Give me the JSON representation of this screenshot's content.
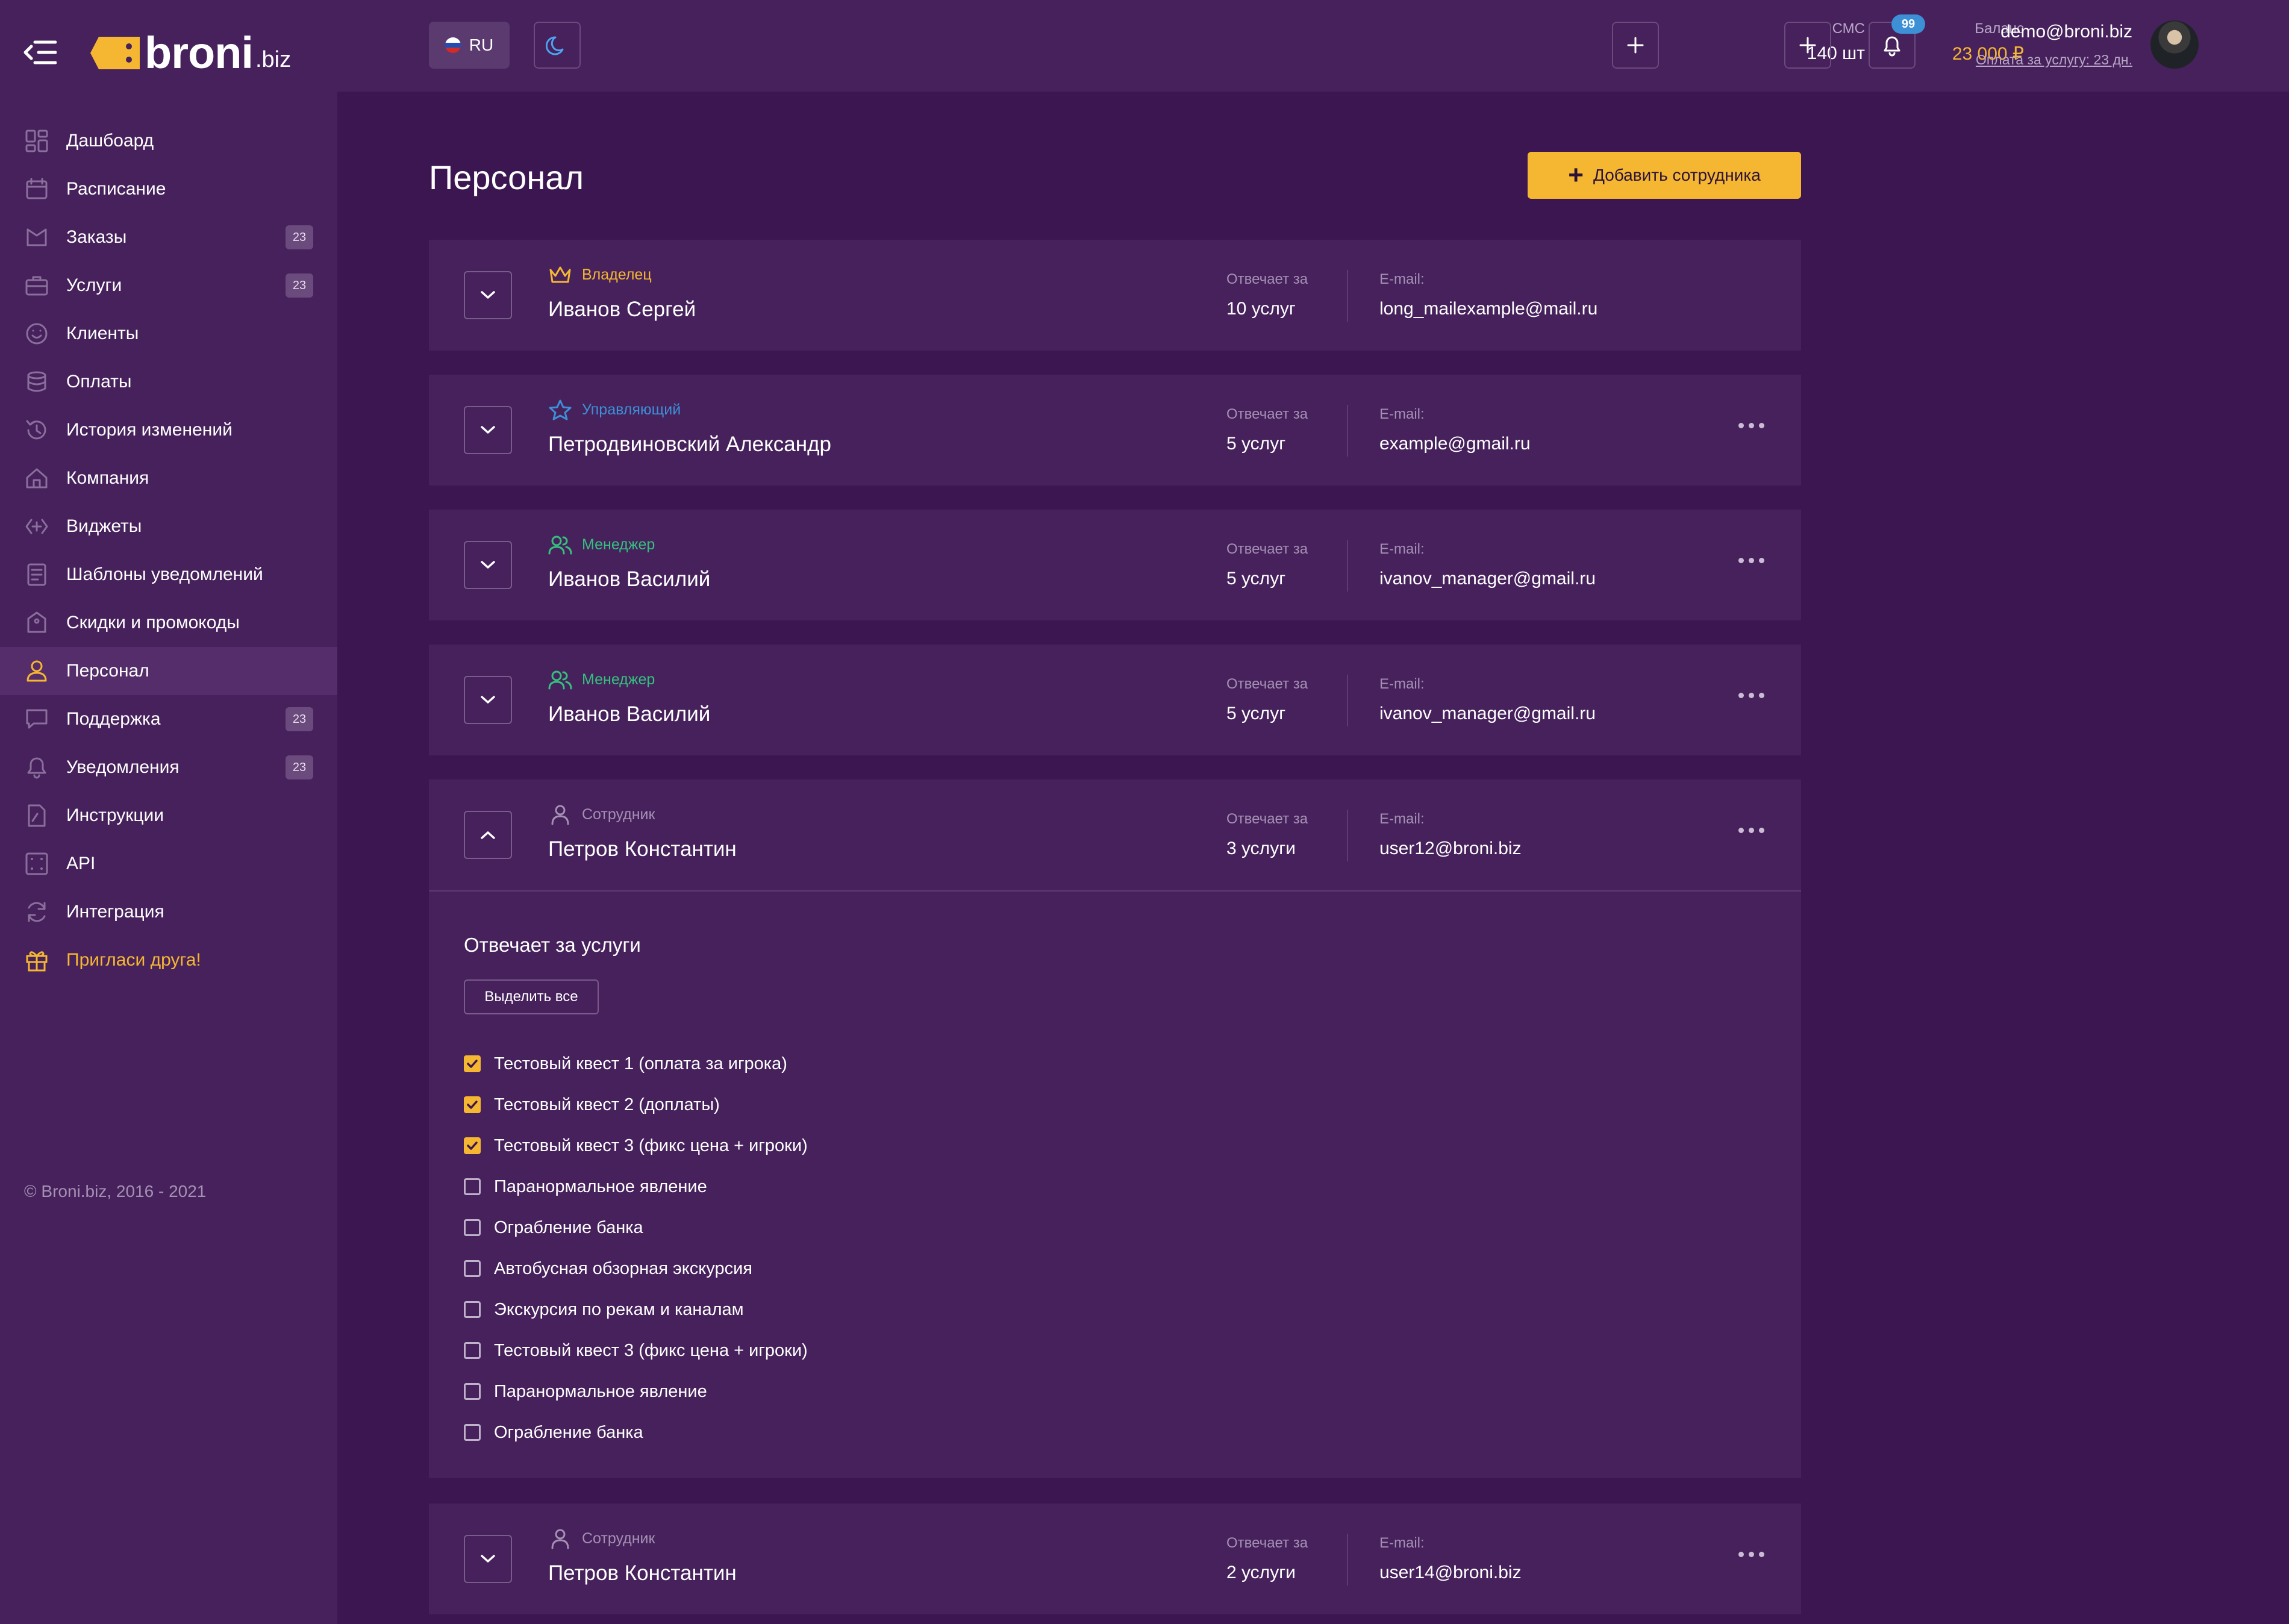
{
  "brand": {
    "name": "broni",
    "suffix": ".biz"
  },
  "sidebar": {
    "items": [
      {
        "label": "Дашбоард",
        "icon": "dashboard-icon",
        "badge": ""
      },
      {
        "label": "Расписание",
        "icon": "calendar-icon",
        "badge": ""
      },
      {
        "label": "Заказы",
        "icon": "orders-icon",
        "badge": "23"
      },
      {
        "label": "Услуги",
        "icon": "briefcase-icon",
        "badge": "23"
      },
      {
        "label": "Клиенты",
        "icon": "smile-icon",
        "badge": ""
      },
      {
        "label": "Оплаты",
        "icon": "coins-icon",
        "badge": ""
      },
      {
        "label": "История изменений",
        "icon": "history-icon",
        "badge": ""
      },
      {
        "label": "Компания",
        "icon": "home-icon",
        "badge": ""
      },
      {
        "label": "Виджеты",
        "icon": "widget-icon",
        "badge": ""
      },
      {
        "label": "Шаблоны уведомлений",
        "icon": "template-icon",
        "badge": ""
      },
      {
        "label": "Скидки и промокоды",
        "icon": "tag-icon",
        "badge": ""
      },
      {
        "label": "Персонал",
        "icon": "user-icon",
        "badge": ""
      },
      {
        "label": "Поддержка",
        "icon": "chat-icon",
        "badge": "23"
      },
      {
        "label": "Уведомления",
        "icon": "bell-icon",
        "badge": "23"
      },
      {
        "label": "Инструкции",
        "icon": "document-icon",
        "badge": ""
      },
      {
        "label": "API",
        "icon": "api-icon",
        "badge": ""
      },
      {
        "label": "Интеграция",
        "icon": "sync-icon",
        "badge": ""
      },
      {
        "label": "Пригласи друга!",
        "icon": "gift-icon",
        "badge": ""
      }
    ],
    "active_index": 11,
    "copyright": "© Broni.biz, 2016 - 2021"
  },
  "topbar": {
    "lang": "RU",
    "sms_label": "СМС",
    "sms_value": "140 шт",
    "balance_label": "Баланс",
    "balance_value": "23 000 ₽",
    "notifications_count": "99",
    "user_email": "demo@broni.biz",
    "user_subscription": "Оплата за услугу: 23 дн."
  },
  "page": {
    "title": "Персонал",
    "add_button": "Добавить сотрудника",
    "resp_label": "Отвечает за",
    "email_label": "E-mail:"
  },
  "staff": [
    {
      "role": "Владелец",
      "role_icon": "crown-icon",
      "role_color": "#f5b731",
      "name": "Иванов Сергей",
      "services": "10 услуг",
      "email": "long_mailexample@mail.ru",
      "has_menu": false,
      "expanded": false
    },
    {
      "role": "Управляющий",
      "role_icon": "star-icon",
      "role_color": "#3d8fd6",
      "name": "Петродвиновский Александр",
      "services": "5 услуг",
      "email": "example@gmail.ru",
      "has_menu": true,
      "expanded": false
    },
    {
      "role": "Менеджер",
      "role_icon": "users-icon",
      "role_color": "#35c07e",
      "name": "Иванов Василий",
      "services": "5 услуг",
      "email": "ivanov_manager@gmail.ru",
      "has_menu": true,
      "expanded": false
    },
    {
      "role": "Менеджер",
      "role_icon": "users-icon",
      "role_color": "#35c07e",
      "name": "Иванов Василий",
      "services": "5 услуг",
      "email": "ivanov_manager@gmail.ru",
      "has_menu": true,
      "expanded": false
    },
    {
      "role": "Сотрудник",
      "role_icon": "person-icon",
      "role_color": "#a590b4",
      "name": "Петров Константин",
      "services": "3 услуги",
      "email": "user12@broni.biz",
      "has_menu": true,
      "expanded": true
    },
    {
      "role": "Сотрудник",
      "role_icon": "person-icon",
      "role_color": "#a590b4",
      "name": "Петров Константин",
      "services": "2 услуги",
      "email": "user14@broni.biz",
      "has_menu": true,
      "expanded": false
    }
  ],
  "expanded_panel": {
    "title": "Отвечает за услуги",
    "select_all": "Выделить все",
    "services": [
      {
        "label": "Тестовый квест 1 (оплата за игрока)",
        "checked": true
      },
      {
        "label": "Тестовый квест 2 (доплаты)",
        "checked": true
      },
      {
        "label": "Тестовый квест 3 (фикс цена + игроки)",
        "checked": true
      },
      {
        "label": "Паранормальное явление",
        "checked": false
      },
      {
        "label": "Ограбление банка",
        "checked": false
      },
      {
        "label": "Автобусная обзорная экскурсия",
        "checked": false
      },
      {
        "label": "Экскурсия по рекам и каналам",
        "checked": false
      },
      {
        "label": "Тестовый квест 3 (фикс цена + игроки)",
        "checked": false
      },
      {
        "label": "Паранормальное явление",
        "checked": false
      },
      {
        "label": "Ограбление банка",
        "checked": false
      }
    ]
  },
  "colors": {
    "accent": "#f5b731",
    "bg": "#3b1650",
    "panel": "#46215c",
    "info": "#3d8fd6"
  }
}
